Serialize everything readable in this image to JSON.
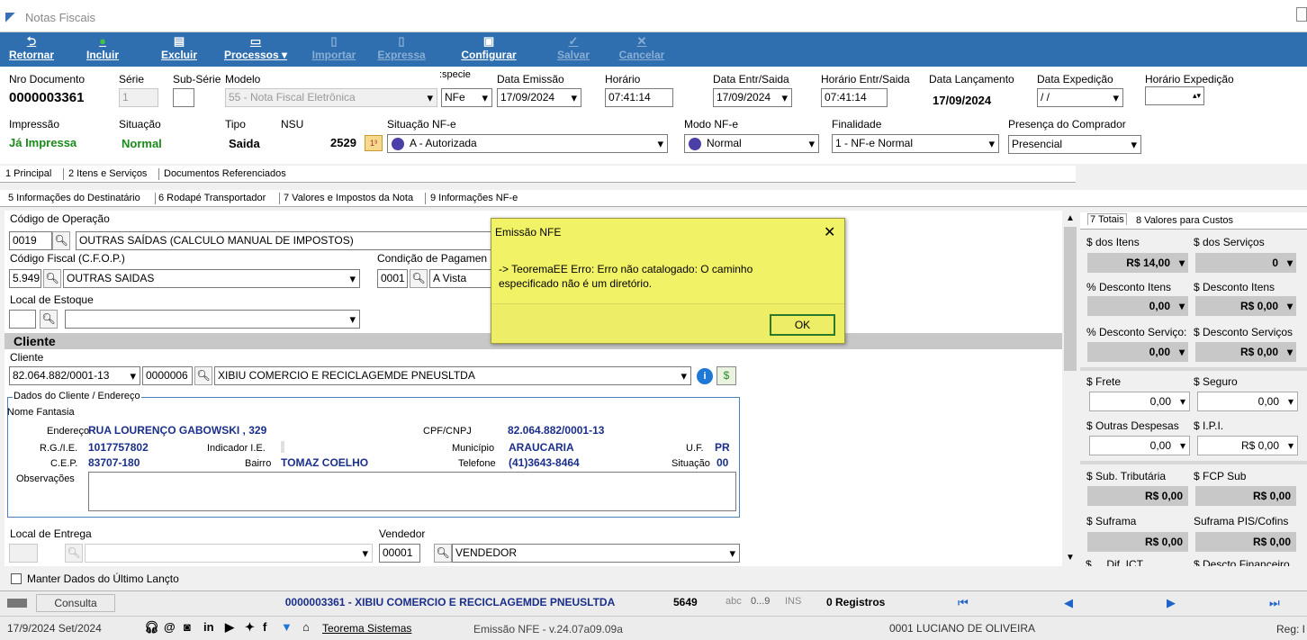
{
  "window": {
    "title": "Notas Fiscais"
  },
  "toolbar": [
    {
      "label": "Retornar",
      "icon": "back-arrow-icon",
      "enabled": true
    },
    {
      "label": "Incluir",
      "icon": "add-icon",
      "enabled": true
    },
    {
      "label": "Excluir",
      "icon": "trash-icon",
      "enabled": true
    },
    {
      "label": "Processos",
      "icon": "printer-icon",
      "enabled": true
    },
    {
      "label": "Importar",
      "icon": "import-icon",
      "enabled": false
    },
    {
      "label": "Expressa",
      "icon": "document-icon",
      "enabled": false
    },
    {
      "label": "Configurar",
      "icon": "configure-icon",
      "enabled": true
    },
    {
      "label": "Salvar",
      "icon": "check-icon",
      "enabled": false
    },
    {
      "label": "Cancelar",
      "icon": "x-icon",
      "enabled": false
    }
  ],
  "header": {
    "nro_documento_label": "Nro Documento",
    "nro_documento": "0000003361",
    "serie_label": "Série",
    "serie": "1",
    "subserie_label": "Sub-Série",
    "modelo_label": "Modelo",
    "modelo": "55 - Nota Fiscal Eletrônica",
    "especie_label": ":specie",
    "especie": "NFe",
    "data_emissao_label": "Data Emissão",
    "data_emissao": "17/09/2024",
    "horario_label": "Horário",
    "horario": "07:41:14",
    "data_entr_label": "Data Entr/Saida",
    "data_entr": "17/09/2024",
    "horario_entr_label": "Horário Entr/Saida",
    "horario_entr": "07:41:14",
    "data_lanc_label": "Data Lançamento",
    "data_lanc": "17/09/2024",
    "data_exp_label": "Data Expedição",
    "data_exp": " / /",
    "horario_exp_label": "Horário Expedição",
    "impressao_label": "Impressão",
    "impressao": "Já Impressa",
    "situacao_label": "Situação",
    "situacao": "Normal",
    "tipo_label": "Tipo",
    "tipo": "Saida",
    "nsu_label": "NSU",
    "nsu": "2529",
    "situacao_nfe_label": "Situação NF-e",
    "situacao_nfe": "A - Autorizada",
    "modo_nfe_label": "Modo NF-e",
    "modo_nfe": "Normal",
    "finalidade_label": "Finalidade",
    "finalidade": "1 - NF-e Normal",
    "presenca_label": "Presença do Comprador",
    "presenca": "Presencial"
  },
  "tabs1": [
    "1 Principal",
    "2 Itens e Serviços",
    "Documentos Referenciados"
  ],
  "tabs2": [
    "5 Informações do Destinatário",
    "6 Rodapé Transportador",
    "7 Valores e Impostos da Nota",
    "9 Informações NF-e"
  ],
  "main": {
    "cod_oper_label": "Código de Operação",
    "cod_oper": "0019",
    "cod_oper_desc": "OUTRAS SAÍDAS (CALCULO MANUAL DE IMPOSTOS)",
    "cfop_label": "Código Fiscal (C.F.O.P.)",
    "cfop": "5.949",
    "cfop_desc": "OUTRAS SAIDAS",
    "cond_pag_label": "Condição de Pagamen",
    "cond_pag": "0001",
    "cond_pag_desc": "A Vista",
    "local_estoque_label": "Local de Estoque",
    "cliente_section": "Cliente",
    "cliente_label": "Cliente",
    "cliente_cnpj": "82.064.882/0001-13",
    "cliente_cod": "0000006",
    "cliente_nome": "XIBIU COMERCIO E RECICLAGEMDE PNEUSLTDA",
    "dados_group": "Dados do Cliente / Endereço",
    "nome_fantasia_label": "Nome Fantasia",
    "endereco_label": "Endereço",
    "endereco": "RUA LOURENÇO GABOWSKI , 329",
    "cpf_label": "CPF/CNPJ",
    "cpf": "82.064.882/0001-13",
    "rg_label": "R.G./I.E.",
    "rg": "1017757802",
    "indicador_label": "Indicador I.E.",
    "municipio_label": "Município",
    "municipio": "ARAUCARIA",
    "uf_label": "U.F.",
    "uf": "PR",
    "cep_label": "C.E.P.",
    "cep": "83707-180",
    "bairro_label": "Bairro",
    "bairro": "TOMAZ COELHO",
    "telefone_label": "Telefone",
    "telefone": "(41)3643-8464",
    "situacao_label": "Situação",
    "situacao": "00",
    "obs_label": "Observações",
    "local_entrega_label": "Local de Entrega",
    "vendedor_label": "Vendedor",
    "vendedor_cod": "00001",
    "vendedor": "VENDEDOR",
    "manter_label": "Manter Dados do Último Lançto"
  },
  "totals": {
    "tabs": [
      "7 Totais",
      "8 Valores para Custos"
    ],
    "dos_itens_label": "$ dos Itens",
    "dos_itens": "R$ 14,00",
    "dos_servicos_label": "$ dos Serviços",
    "dos_servicos": "0",
    "desc_itens_pct_label": "% Desconto Itens",
    "desc_itens_pct": "0,00",
    "desc_itens_label": "$ Desconto Itens",
    "desc_itens": "R$ 0,00",
    "desc_serv_pct_label": "% Desconto Serviço:",
    "desc_serv_pct": "0,00",
    "desc_serv_label": "$ Desconto Serviços",
    "desc_serv": "R$ 0,00",
    "frete_label": "$ Frete",
    "frete": "0,00",
    "seguro_label": "$ Seguro",
    "seguro": "0,00",
    "outras_label": "$ Outras Despesas",
    "outras": "0,00",
    "ipi_label": "$ I.P.I.",
    "ipi": "R$ 0,00",
    "sub_trib_label": "$ Sub. Tributária",
    "sub_trib": "R$ 0,00",
    "fcp_label": "$ FCP Sub",
    "fcp": "R$ 0,00",
    "suframa_label": "$ Suframa",
    "suframa": "R$ 0,00",
    "suframa_pis_label": "Suframa PIS/Cofins",
    "suframa_pis": "R$ 0,00",
    "cut_left": "$ ... Dif. ICT",
    "cut_right": "$ Descto Financeiro"
  },
  "dialog": {
    "title": "Emissão NFE",
    "message": "-> TeoremaEE Erro: Erro não catalogado: O caminho especificado não é um diretório.",
    "ok": "OK"
  },
  "status1": {
    "consulta": "Consulta",
    "record": "0000003361 - XIBIU COMERCIO E RECICLAGEMDE PNEUSLTDA",
    "num": "5649",
    "abc": "abc",
    "digits": "0...9",
    "ins": "INS",
    "registros": "0 Registros"
  },
  "status2": {
    "date": "17/9/2024 Set/2024",
    "company": "Teorema Sistemas",
    "version": "Emissão NFE - v.24.07a09.09a",
    "user": "0001 LUCIANO DE OLIVEIRA",
    "reg": "Reg: I"
  }
}
